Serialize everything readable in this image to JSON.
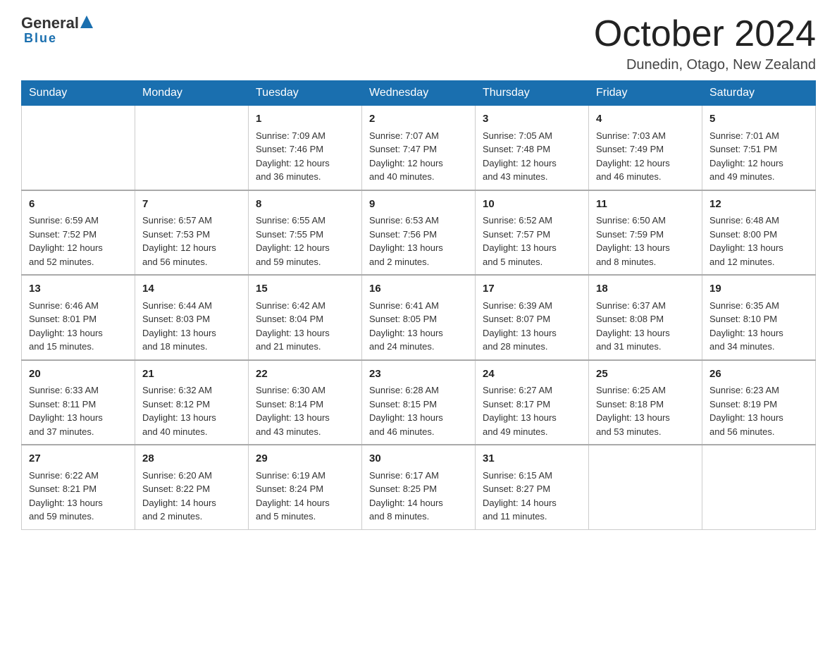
{
  "header": {
    "logo_general": "General",
    "logo_blue": "Blue",
    "title": "October 2024",
    "location": "Dunedin, Otago, New Zealand"
  },
  "weekdays": [
    "Sunday",
    "Monday",
    "Tuesday",
    "Wednesday",
    "Thursday",
    "Friday",
    "Saturday"
  ],
  "weeks": [
    [
      {
        "day": "",
        "info": ""
      },
      {
        "day": "",
        "info": ""
      },
      {
        "day": "1",
        "info": "Sunrise: 7:09 AM\nSunset: 7:46 PM\nDaylight: 12 hours\nand 36 minutes."
      },
      {
        "day": "2",
        "info": "Sunrise: 7:07 AM\nSunset: 7:47 PM\nDaylight: 12 hours\nand 40 minutes."
      },
      {
        "day": "3",
        "info": "Sunrise: 7:05 AM\nSunset: 7:48 PM\nDaylight: 12 hours\nand 43 minutes."
      },
      {
        "day": "4",
        "info": "Sunrise: 7:03 AM\nSunset: 7:49 PM\nDaylight: 12 hours\nand 46 minutes."
      },
      {
        "day": "5",
        "info": "Sunrise: 7:01 AM\nSunset: 7:51 PM\nDaylight: 12 hours\nand 49 minutes."
      }
    ],
    [
      {
        "day": "6",
        "info": "Sunrise: 6:59 AM\nSunset: 7:52 PM\nDaylight: 12 hours\nand 52 minutes."
      },
      {
        "day": "7",
        "info": "Sunrise: 6:57 AM\nSunset: 7:53 PM\nDaylight: 12 hours\nand 56 minutes."
      },
      {
        "day": "8",
        "info": "Sunrise: 6:55 AM\nSunset: 7:55 PM\nDaylight: 12 hours\nand 59 minutes."
      },
      {
        "day": "9",
        "info": "Sunrise: 6:53 AM\nSunset: 7:56 PM\nDaylight: 13 hours\nand 2 minutes."
      },
      {
        "day": "10",
        "info": "Sunrise: 6:52 AM\nSunset: 7:57 PM\nDaylight: 13 hours\nand 5 minutes."
      },
      {
        "day": "11",
        "info": "Sunrise: 6:50 AM\nSunset: 7:59 PM\nDaylight: 13 hours\nand 8 minutes."
      },
      {
        "day": "12",
        "info": "Sunrise: 6:48 AM\nSunset: 8:00 PM\nDaylight: 13 hours\nand 12 minutes."
      }
    ],
    [
      {
        "day": "13",
        "info": "Sunrise: 6:46 AM\nSunset: 8:01 PM\nDaylight: 13 hours\nand 15 minutes."
      },
      {
        "day": "14",
        "info": "Sunrise: 6:44 AM\nSunset: 8:03 PM\nDaylight: 13 hours\nand 18 minutes."
      },
      {
        "day": "15",
        "info": "Sunrise: 6:42 AM\nSunset: 8:04 PM\nDaylight: 13 hours\nand 21 minutes."
      },
      {
        "day": "16",
        "info": "Sunrise: 6:41 AM\nSunset: 8:05 PM\nDaylight: 13 hours\nand 24 minutes."
      },
      {
        "day": "17",
        "info": "Sunrise: 6:39 AM\nSunset: 8:07 PM\nDaylight: 13 hours\nand 28 minutes."
      },
      {
        "day": "18",
        "info": "Sunrise: 6:37 AM\nSunset: 8:08 PM\nDaylight: 13 hours\nand 31 minutes."
      },
      {
        "day": "19",
        "info": "Sunrise: 6:35 AM\nSunset: 8:10 PM\nDaylight: 13 hours\nand 34 minutes."
      }
    ],
    [
      {
        "day": "20",
        "info": "Sunrise: 6:33 AM\nSunset: 8:11 PM\nDaylight: 13 hours\nand 37 minutes."
      },
      {
        "day": "21",
        "info": "Sunrise: 6:32 AM\nSunset: 8:12 PM\nDaylight: 13 hours\nand 40 minutes."
      },
      {
        "day": "22",
        "info": "Sunrise: 6:30 AM\nSunset: 8:14 PM\nDaylight: 13 hours\nand 43 minutes."
      },
      {
        "day": "23",
        "info": "Sunrise: 6:28 AM\nSunset: 8:15 PM\nDaylight: 13 hours\nand 46 minutes."
      },
      {
        "day": "24",
        "info": "Sunrise: 6:27 AM\nSunset: 8:17 PM\nDaylight: 13 hours\nand 49 minutes."
      },
      {
        "day": "25",
        "info": "Sunrise: 6:25 AM\nSunset: 8:18 PM\nDaylight: 13 hours\nand 53 minutes."
      },
      {
        "day": "26",
        "info": "Sunrise: 6:23 AM\nSunset: 8:19 PM\nDaylight: 13 hours\nand 56 minutes."
      }
    ],
    [
      {
        "day": "27",
        "info": "Sunrise: 6:22 AM\nSunset: 8:21 PM\nDaylight: 13 hours\nand 59 minutes."
      },
      {
        "day": "28",
        "info": "Sunrise: 6:20 AM\nSunset: 8:22 PM\nDaylight: 14 hours\nand 2 minutes."
      },
      {
        "day": "29",
        "info": "Sunrise: 6:19 AM\nSunset: 8:24 PM\nDaylight: 14 hours\nand 5 minutes."
      },
      {
        "day": "30",
        "info": "Sunrise: 6:17 AM\nSunset: 8:25 PM\nDaylight: 14 hours\nand 8 minutes."
      },
      {
        "day": "31",
        "info": "Sunrise: 6:15 AM\nSunset: 8:27 PM\nDaylight: 14 hours\nand 11 minutes."
      },
      {
        "day": "",
        "info": ""
      },
      {
        "day": "",
        "info": ""
      }
    ]
  ]
}
